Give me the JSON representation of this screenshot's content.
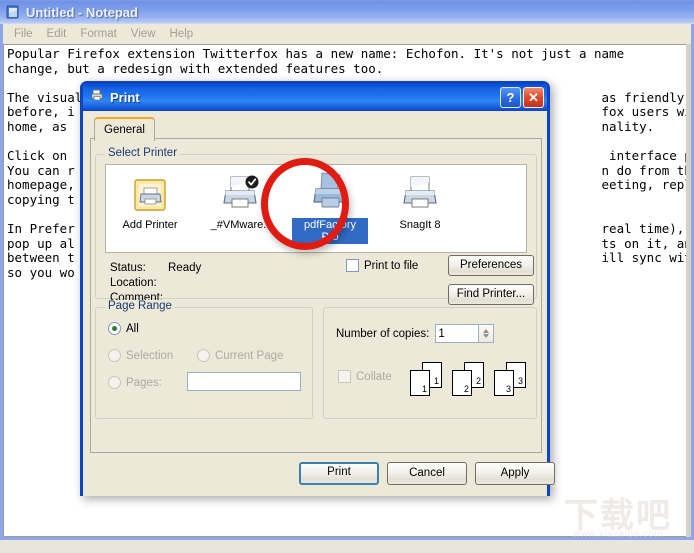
{
  "notepad": {
    "title": "Untitled - Notepad",
    "icon": "notepad-icon",
    "menu": [
      "File",
      "Edit",
      "Format",
      "View",
      "Help"
    ],
    "document_text": "Popular Firefox extension Twitterfox has a new name: Echofon. It's not just a name\nchange, but a redesign with extended features too.\n\nThe visual                                                                     as friendly as\nbefore, i                                                                      fox users will fe\nhome, as                                                                       nality.\n\nClick on                                                                        interface pops u\nYou can r                                                                      n do from the Twi\nhomepage,                                                                      eeting, replying\ncopying t\n\nIn Prefer                                                                      real time), and t\npop up al                                                                      ts on it, and cha\nbetween t                                                                      ill sync with Fir\nso you wo"
  },
  "print_dialog": {
    "title": "Print",
    "icon": "printer-icon",
    "help_button": "?",
    "close_button": "✕",
    "tabs": [
      {
        "label": "General",
        "active": true
      }
    ],
    "select_printer": {
      "group_label": "Select Printer",
      "printers": [
        {
          "name": "Add Printer",
          "icon": "add-printer-icon",
          "selected": false,
          "default": false
        },
        {
          "name": "_#VMware..",
          "icon": "printer-icon",
          "selected": false,
          "default": true
        },
        {
          "name": "pdfFactory\nPro",
          "icon": "printer-icon",
          "selected": true,
          "default": false
        },
        {
          "name": "SnagIt 8",
          "icon": "printer-icon",
          "selected": false,
          "default": false
        }
      ],
      "status_label": "Status:",
      "status_value": "Ready",
      "location_label": "Location:",
      "location_value": "",
      "comment_label": "Comment:",
      "comment_value": "",
      "print_to_file_label": "Print to file",
      "print_to_file_checked": false,
      "preferences_button": "Preferences",
      "find_printer_button": "Find Printer..."
    },
    "page_range": {
      "group_label": "Page Range",
      "options": [
        {
          "label": "All",
          "checked": true,
          "disabled": false
        },
        {
          "label": "Selection",
          "checked": false,
          "disabled": true
        },
        {
          "label": "Current Page",
          "checked": false,
          "disabled": true
        },
        {
          "label": "Pages:",
          "checked": false,
          "disabled": true
        }
      ],
      "pages_value": "",
      "pages_placeholder": ""
    },
    "copies": {
      "number_label": "Number of copies:",
      "number_value": "1",
      "collate_label": "Collate",
      "collate_checked": false,
      "collate_disabled": true,
      "collate_pages": [
        "1",
        "1",
        "2",
        "2",
        "3",
        "3"
      ]
    },
    "footer": {
      "print_button": "Print",
      "cancel_button": "Cancel",
      "apply_button": "Apply"
    },
    "annotation": {
      "shape": "circle",
      "color": "#e01b12",
      "target": "pdfFactory Pro"
    }
  },
  "watermark": {
    "text_cn": "下载吧",
    "url": "www.xiazaiba.com"
  }
}
